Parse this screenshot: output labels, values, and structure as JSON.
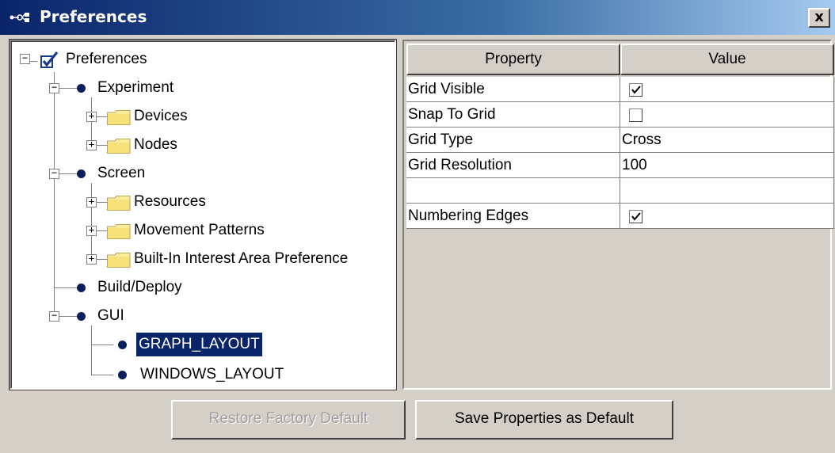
{
  "window": {
    "title": "Preferences",
    "close_label": "x"
  },
  "tree": {
    "root": {
      "label": "Preferences",
      "icon": "checked-checkbox-icon",
      "expanded": true
    },
    "nodes": [
      {
        "label": "Experiment",
        "icon": "bullet-icon",
        "expanded": true,
        "selected": false
      },
      {
        "label": "Devices",
        "icon": "folder-icon",
        "expanded": false,
        "selected": false
      },
      {
        "label": "Nodes",
        "icon": "folder-icon",
        "expanded": false,
        "selected": false
      },
      {
        "label": "Screen",
        "icon": "bullet-icon",
        "expanded": true,
        "selected": false
      },
      {
        "label": "Resources",
        "icon": "folder-icon",
        "expanded": false,
        "selected": false
      },
      {
        "label": "Movement Patterns",
        "icon": "folder-icon",
        "expanded": false,
        "selected": false
      },
      {
        "label": "Built-In Interest Area Preference",
        "icon": "folder-icon",
        "expanded": false,
        "selected": false
      },
      {
        "label": "Build/Deploy",
        "icon": "bullet-icon",
        "expanded": null,
        "selected": false
      },
      {
        "label": "GUI",
        "icon": "bullet-icon",
        "expanded": true,
        "selected": false
      },
      {
        "label": "GRAPH_LAYOUT",
        "icon": "bullet-icon",
        "expanded": null,
        "selected": true
      },
      {
        "label": "WINDOWS_LAYOUT",
        "icon": "bullet-icon",
        "expanded": null,
        "selected": false
      }
    ]
  },
  "properties": {
    "columns": [
      "Property",
      "Value"
    ],
    "rows": [
      {
        "property": "Grid Visible",
        "value": "",
        "checkbox": true,
        "checked": true
      },
      {
        "property": "Snap To Grid",
        "value": "",
        "checkbox": true,
        "checked": false
      },
      {
        "property": "Grid Type",
        "value": "Cross",
        "checkbox": false,
        "checked": false
      },
      {
        "property": "Grid Resolution",
        "value": "100",
        "checkbox": false,
        "checked": false
      },
      {
        "property": "",
        "value": "",
        "checkbox": false,
        "checked": false
      },
      {
        "property": "Numbering Edges",
        "value": "",
        "checkbox": true,
        "checked": true
      }
    ]
  },
  "buttons": {
    "restore": {
      "label": "Restore Factory Default",
      "enabled": false
    },
    "save": {
      "label": "Save Properties as Default",
      "enabled": true
    }
  },
  "colors": {
    "title_gradient_start": "#0a246a",
    "title_gradient_end": "#a6caf0",
    "selection": "#0a246a",
    "face": "#d4d0c8",
    "bullet": "#0a1f5c"
  }
}
